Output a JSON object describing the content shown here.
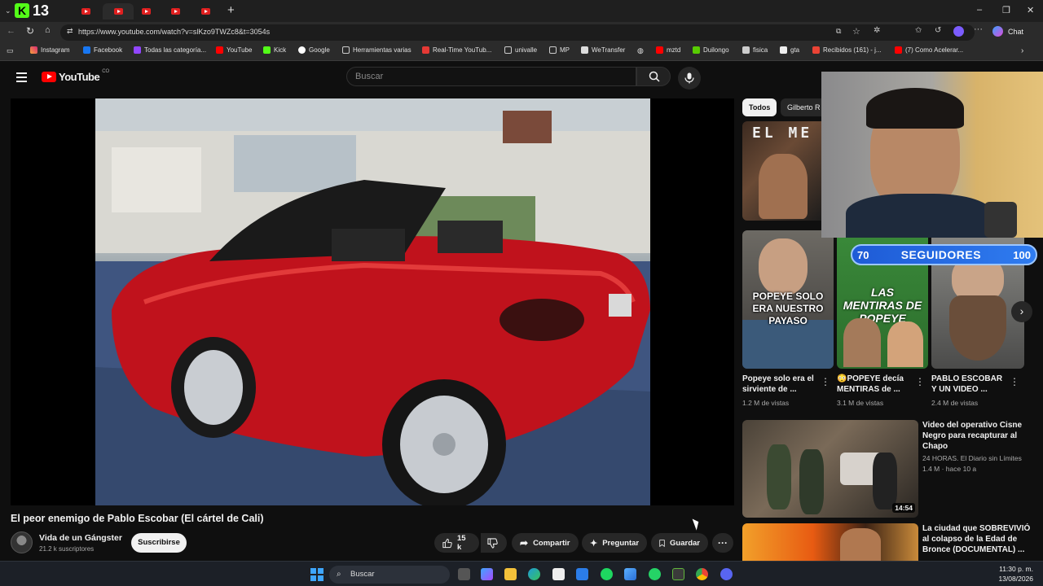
{
  "browser": {
    "url": "https://www.youtube.com/watch?v=slKzo9TWZc8&t=3054s",
    "kick_badge": "13",
    "chat_label": "Chat",
    "bookmarks": [
      "Instagram",
      "Facebook",
      "Todas las categoría...",
      "YouTube",
      "Kick",
      "Google",
      "Herramientas varias",
      "Real-Time YouTub...",
      "univalle",
      "MP",
      "WeTransfer",
      "mztd",
      "Duilongo",
      "fisica",
      "gta",
      "Recibidos (161) - j...",
      "(7) Como Acelerar..."
    ]
  },
  "youtube": {
    "logo": "YouTube",
    "country": "CO",
    "search_placeholder": "Buscar"
  },
  "video": {
    "title": "El peor enemigo de Pablo Escobar (El cártel de Cali)",
    "channel": "Vida de un Gángster",
    "subscribers": "21.2 k suscriptores",
    "subscribe_label": "Suscribirse",
    "likes": "15 k",
    "share_label": "Compartir",
    "ask_label": "Preguntar",
    "save_label": "Guardar"
  },
  "sidebar": {
    "chips": [
      "Todos",
      "Gilberto R"
    ],
    "top_thumb_text": "EL ME",
    "shorts": [
      {
        "title": "Popeye solo era el sirviente de ...",
        "views": "1.2 M de vistas",
        "overlay": "POPEYE SOLO ERA NUESTRO PAYASO"
      },
      {
        "title": "😳POPEYE decía MENTIRAS de ...",
        "views": "3.1 M de vistas",
        "overlay": "LAS MENTIRAS DE POPEYE"
      },
      {
        "title": "PABLO ESCOBAR Y UN VIDEO ...",
        "views": "2.4 M de vistas",
        "overlay": ""
      }
    ],
    "videos": [
      {
        "title": "Video del operativo Cisne Negro para recapturar al Chapo",
        "channel": "24 HORAS. El Diario sin Límites",
        "meta": "1.4 M · hace 10 a",
        "duration": "14:54"
      },
      {
        "title": "La ciudad que SOBREVIVIÓ al colapso de la Edad de Bronce (DOCUMENTAL) ...",
        "channel": "",
        "meta": "",
        "duration": ""
      }
    ]
  },
  "overlay": {
    "followers_current": "70",
    "followers_label": "SEGUIDORES",
    "followers_goal": "100"
  },
  "taskbar": {
    "search_label": "Buscar",
    "time": "11:30 p. m.",
    "date": "13/08/2026"
  },
  "colors": {
    "yt_red": "#ff0000",
    "background": "#0f0f0f",
    "followers_blue": "#1e5bd6"
  }
}
